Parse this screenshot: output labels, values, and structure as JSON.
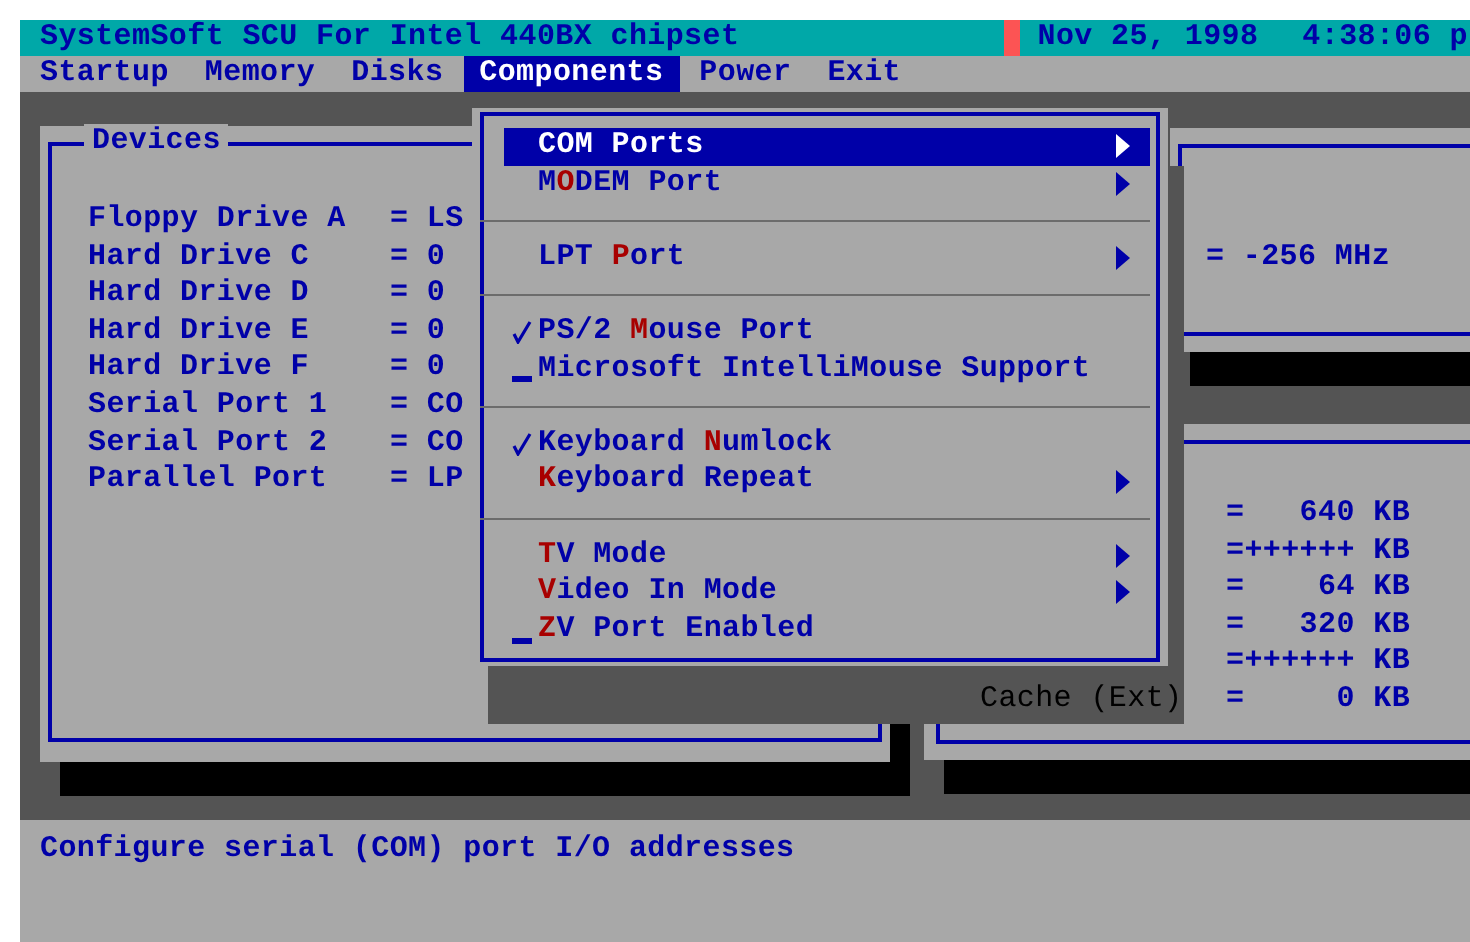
{
  "title_bar": {
    "title": "SystemSoft SCU For Intel 440BX chipset",
    "date": "Nov 25, 1998",
    "time": "4:38:06 p"
  },
  "menu_bar": [
    {
      "label": "Startup",
      "selected": false
    },
    {
      "label": "Memory",
      "selected": false
    },
    {
      "label": "Disks",
      "selected": false
    },
    {
      "label": "Components",
      "selected": true
    },
    {
      "label": "Power",
      "selected": false
    },
    {
      "label": "Exit",
      "selected": false
    }
  ],
  "devices": {
    "title": "Devices",
    "rows": [
      {
        "name": "Floppy Drive A",
        "value": "= LS"
      },
      {
        "name": "Hard Drive C",
        "value": "= 0"
      },
      {
        "name": "Hard Drive D",
        "value": "= 0"
      },
      {
        "name": "Hard Drive E",
        "value": "= 0"
      },
      {
        "name": "Hard Drive F",
        "value": "= 0"
      },
      {
        "name": "Serial Port 1",
        "value": "= CO"
      },
      {
        "name": "Serial Port 2",
        "value": "= CO"
      },
      {
        "name": "Parallel Port",
        "value": "= LP"
      }
    ]
  },
  "cpu_panel": {
    "value": "= -256 MHz"
  },
  "memory_panel": {
    "rows": [
      {
        "value": "=   640 KB"
      },
      {
        "value": "=++++++ KB"
      },
      {
        "value": "=    64 KB"
      },
      {
        "value": "=   320 KB"
      },
      {
        "value": "=++++++ KB"
      },
      {
        "label": "Cache (Ext)",
        "value": "=     0 KB"
      }
    ]
  },
  "components_menu": [
    {
      "kind": "submenu",
      "post": "COM Ports",
      "selected": true
    },
    {
      "kind": "submenu",
      "pre": "M",
      "key": "O",
      "post": "DEM Port",
      "selected": false
    },
    {
      "kind": "separator"
    },
    {
      "kind": "submenu",
      "pre": "LPT ",
      "key": "P",
      "post": "ort",
      "selected": false
    },
    {
      "kind": "separator"
    },
    {
      "kind": "check",
      "pre": "PS/2 ",
      "key": "M",
      "post": "ouse Port",
      "checked": true,
      "selected": false
    },
    {
      "kind": "check",
      "post": "Microsoft IntelliMouse Support",
      "checked": false,
      "selected": false
    },
    {
      "kind": "separator"
    },
    {
      "kind": "check",
      "pre": "Keyboard ",
      "key": "N",
      "post": "umlock",
      "checked": true,
      "selected": false
    },
    {
      "kind": "submenu",
      "key": "K",
      "post": "eyboard Repeat",
      "selected": false
    },
    {
      "kind": "separator"
    },
    {
      "kind": "submenu",
      "key": "T",
      "post": "V Mode",
      "selected": false
    },
    {
      "kind": "submenu",
      "key": "V",
      "post": "ideo In Mode",
      "selected": false
    },
    {
      "kind": "check",
      "key": "Z",
      "post": "V Port Enabled",
      "checked": false,
      "selected": false
    }
  ],
  "status_bar": {
    "text": "Configure serial (COM) port I/O addresses"
  }
}
